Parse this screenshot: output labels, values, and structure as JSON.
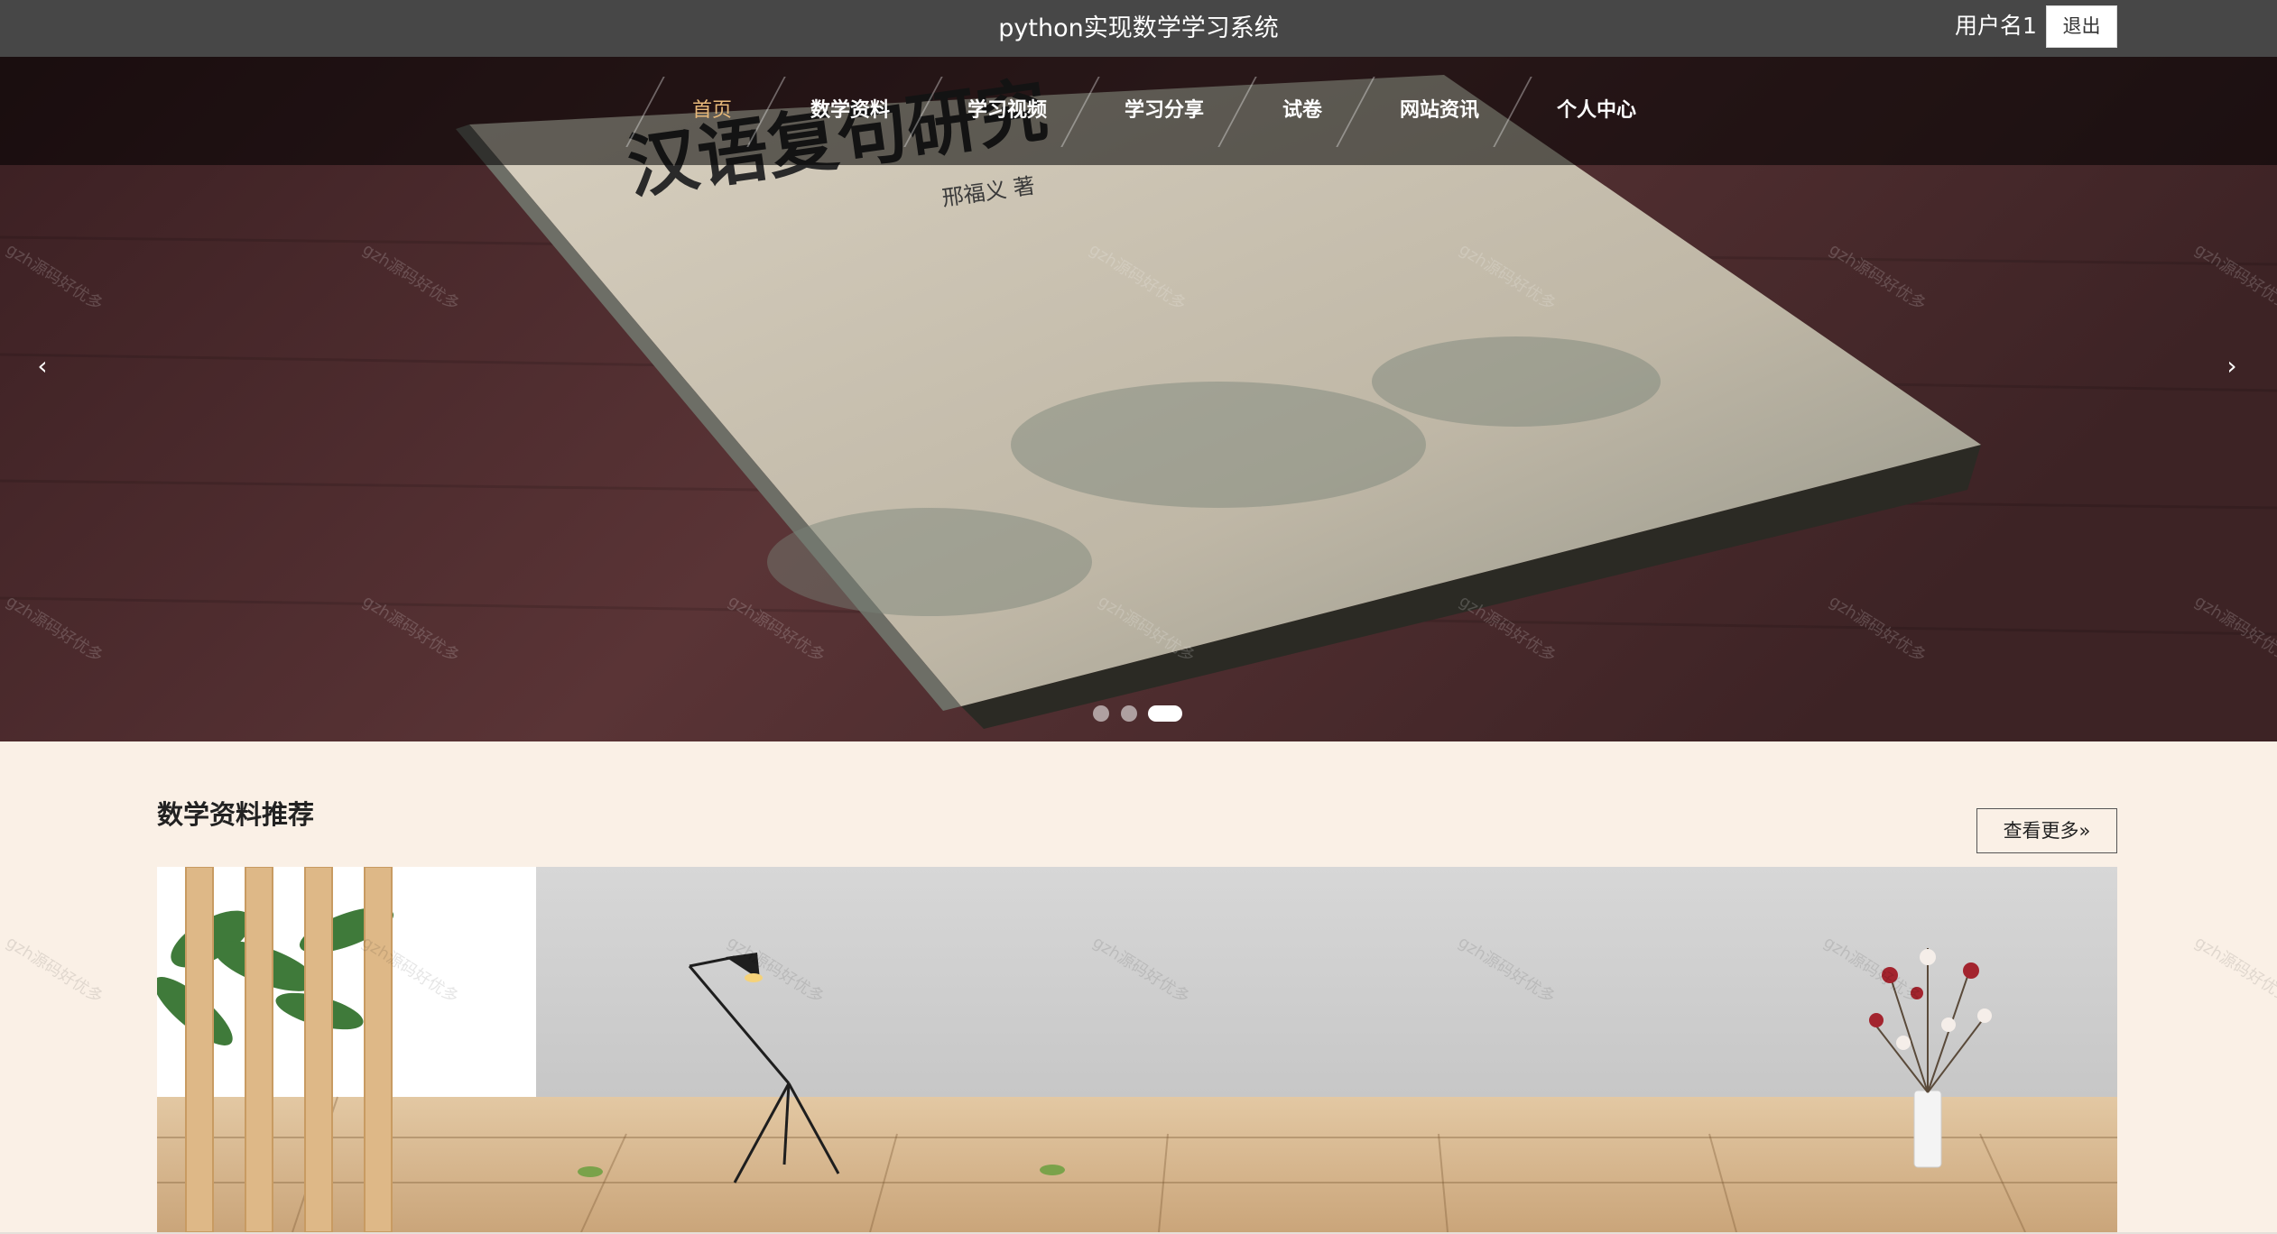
{
  "header": {
    "title": "python实现数学学习系统",
    "user_name": "用户名1",
    "logout_label": "退出"
  },
  "nav": {
    "items": [
      {
        "label": "首页",
        "active": true
      },
      {
        "label": "数学资料"
      },
      {
        "label": "学习视频"
      },
      {
        "label": "学习分享"
      },
      {
        "label": "试卷"
      },
      {
        "label": "网站资讯"
      },
      {
        "label": "个人中心"
      }
    ]
  },
  "carousel": {
    "prev_icon": "‹",
    "next_icon": "›",
    "slide_count": 3,
    "active_index": 2,
    "book_title": "汉语复句研究",
    "book_author": "邢福义 著"
  },
  "section": {
    "title": "数学资料推荐",
    "more_label": "查看更多»"
  },
  "watermark_text": "gzh源码好优多",
  "colors": {
    "topbar": "#474747",
    "active_nav": "#e8b97a",
    "page_bg": "#faf0e6"
  }
}
